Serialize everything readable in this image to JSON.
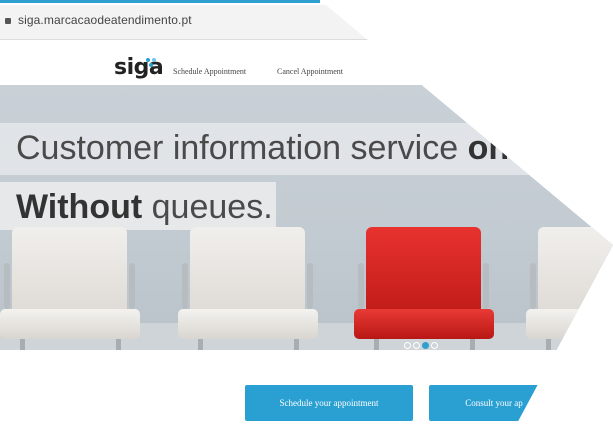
{
  "browser": {
    "url": "siga.marcacaodeatendimento.pt"
  },
  "navbar": {
    "logo_text": "siga",
    "links": [
      "Schedule Appointment",
      "Cancel Appointment"
    ]
  },
  "hero": {
    "line1_regular": "Customer information service ",
    "line1_bold": "on th",
    "line2_bold": "Without",
    "line2_regular": " queues.",
    "slider_active_index": 2,
    "slider_count": 4
  },
  "actions": {
    "schedule_label": "Schedule your appointment",
    "consult_label": "Consult your ap"
  },
  "colors": {
    "accent": "#2a9fd2",
    "chair_red": "#d8241f",
    "logo_dots": [
      "#2a9fd2",
      "#6ec6e8",
      "#2a9fd2"
    ]
  }
}
